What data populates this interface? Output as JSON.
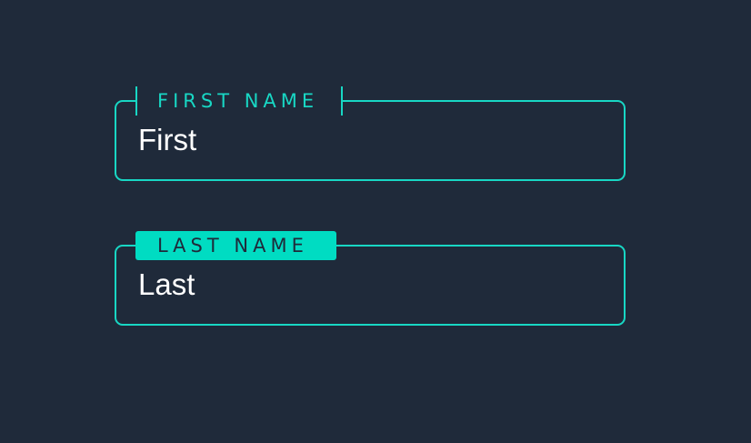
{
  "colors": {
    "background": "#1f2a3a",
    "accent": "#18d7c4",
    "accent_fill": "#00dcc2",
    "text": "#ffffff"
  },
  "form": {
    "first_name": {
      "label": "FIRST NAME",
      "value": "First"
    },
    "last_name": {
      "label": "LAST NAME",
      "value": "Last"
    }
  }
}
